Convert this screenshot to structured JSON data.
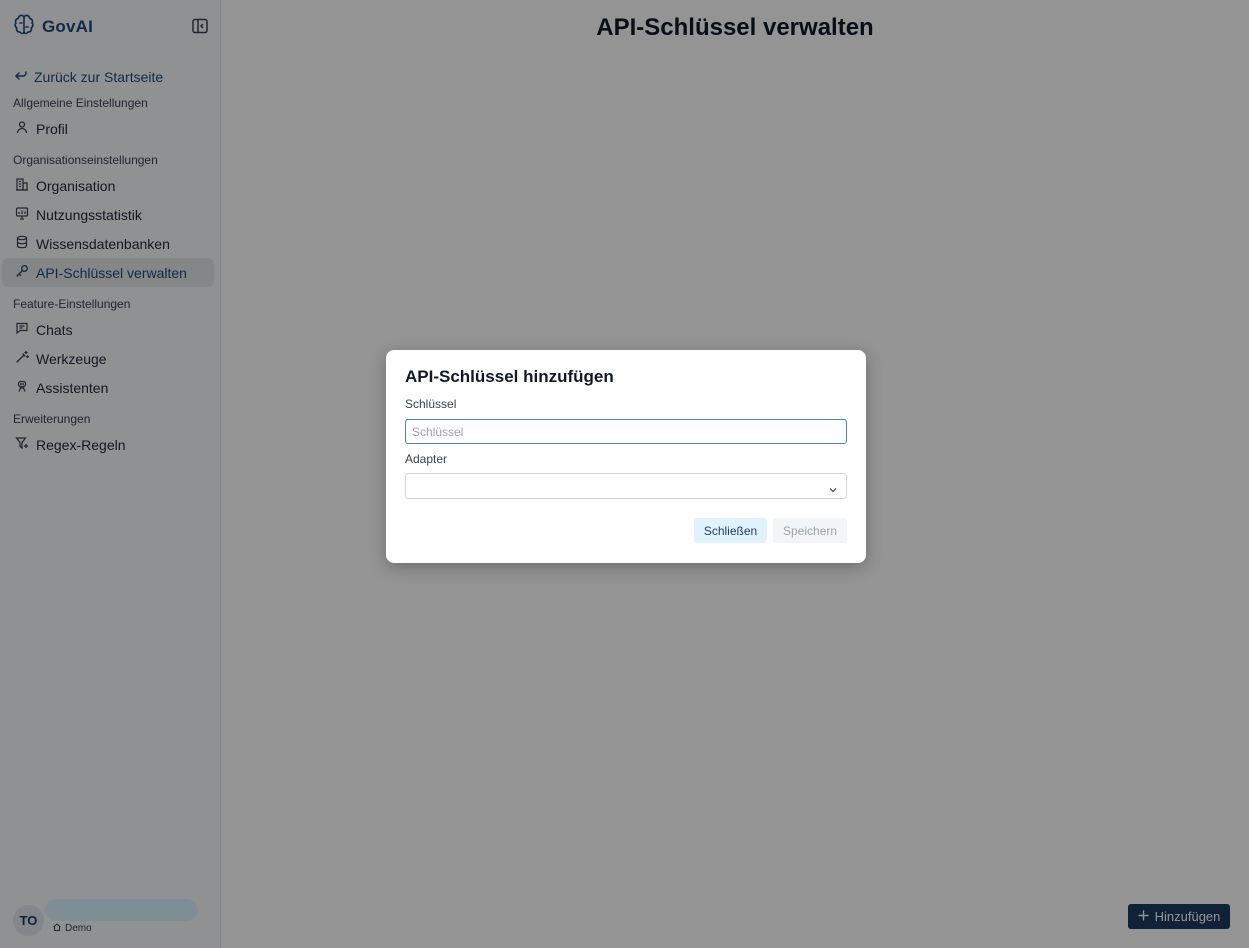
{
  "app": {
    "name": "GovAI"
  },
  "sidebar": {
    "back_label": "Zurück zur Startseite",
    "sections": [
      {
        "label": "Allgemeine Einstellungen"
      },
      {
        "label": "Organisationseinstellungen"
      },
      {
        "label": "Feature-Einstellungen"
      },
      {
        "label": "Erweiterungen"
      }
    ],
    "items": [
      {
        "label": "Profil",
        "icon": "user-icon"
      },
      {
        "label": "Organisation",
        "icon": "building-icon"
      },
      {
        "label": "Nutzungsstatistik",
        "icon": "presentation-chart-icon"
      },
      {
        "label": "Wissensdatenbanken",
        "icon": "database-icon"
      },
      {
        "label": "API-Schlüssel verwalten",
        "icon": "key-icon",
        "active": true
      },
      {
        "label": "Chats",
        "icon": "message-icon"
      },
      {
        "label": "Werkzeuge",
        "icon": "wand-icon"
      },
      {
        "label": "Assistenten",
        "icon": "robot-icon"
      },
      {
        "label": "Regex-Regeln",
        "icon": "filter-icon"
      }
    ]
  },
  "user": {
    "initials": "TO",
    "org": "Demo"
  },
  "main": {
    "title": "API-Schlüssel verwalten",
    "add_button": "Hinzufügen"
  },
  "modal": {
    "title": "API-Schlüssel hinzufügen",
    "key_label": "Schlüssel",
    "key_placeholder": "Schlüssel",
    "key_value": "",
    "adapter_label": "Adapter",
    "adapter_value": "",
    "close_button": "Schließen",
    "save_button": "Speichern"
  },
  "colors": {
    "brand": "#1e4a7c",
    "primary_button": "#1e3a5f",
    "secondary_button": "#e0f2fe",
    "overlay": "rgba(0,0,0,0.42)"
  }
}
